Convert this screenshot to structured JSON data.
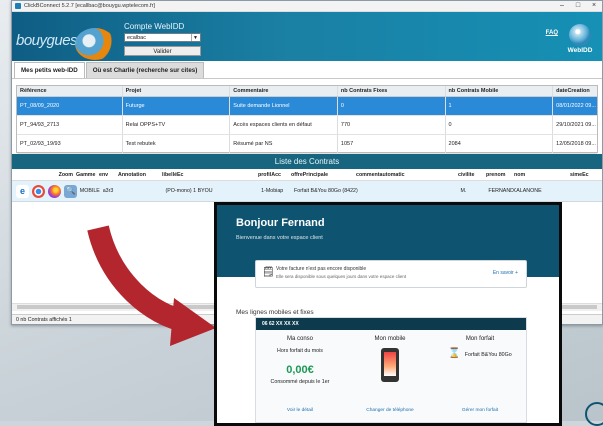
{
  "window": {
    "title": "ClickBConnect 5.2.7 [ecallbac@bouygu.wptelecom.fr]",
    "controls": [
      "–",
      "□",
      "×"
    ]
  },
  "header": {
    "brand": "bouygues",
    "compte_label": "Compte WebIDD",
    "compte_value": "ecalbac",
    "valider_label": "Valider",
    "faq_label": "FAQ",
    "webidd_label": "WebIDD"
  },
  "tabs": [
    {
      "label": "Mes petits web-IDD",
      "active": true
    },
    {
      "label": "Où est Charlie (recherche sur cites)",
      "active": false
    }
  ],
  "accounts_table": {
    "columns": [
      "Référence",
      "Projet",
      "Commentaire",
      "nb Contrats Fixes",
      "nb Contrats Mobile",
      "dateCreation"
    ],
    "rows": [
      {
        "ref": "PT_08/09_2020",
        "projet": "Futurge",
        "comment": "Suite demande Lionnel",
        "fix": "0",
        "mob": "1",
        "date": "08/01/2022 09...",
        "selected": true
      },
      {
        "ref": "PT_94/93_2713",
        "projet": "Relai OPPS+TV",
        "comment": "Accès espaces clients en défaut",
        "fix": "770",
        "mob": "0",
        "date": "29/10/2021 09...",
        "selected": false
      },
      {
        "ref": "PT_02/93_19/93",
        "projet": "Test rebutek",
        "comment": "Résumé par NS",
        "fix": "1057",
        "mob": "2084",
        "date": "12/05/2018 09...",
        "selected": false
      }
    ]
  },
  "contracts": {
    "title": "Liste des Contrats",
    "columns": [
      "Zoom",
      "Gamme",
      "env",
      "Annotation",
      "libelléEc",
      "profilAcc",
      "offrePrincipale",
      "commentautomatic",
      "civilite",
      "prenom",
      "nom",
      "simeEc"
    ],
    "row": {
      "gamme": "MOBILE",
      "env": "a3r3",
      "annotation": "",
      "libelle": "(PO-mono) 1 BYOU",
      "profil": "1-Mobiap",
      "offre": "Forfait B&You 80Go (8422)",
      "commentaire": "",
      "civilite": "M.",
      "prenom": "FERNANDO",
      "nom": "ALANONE",
      "sime": ""
    },
    "icons": [
      "ie-icon",
      "chrome-icon",
      "firefox-icon",
      "zoom-icon"
    ]
  },
  "statusbar": {
    "text": "0 nb Contrats affichés 1"
  },
  "inset": {
    "greeting": "Bonjour Fernand",
    "welcome": "Bienvenue dans votre espace client",
    "alert_line1": "Votre facture n'est pas encore disponible",
    "alert_line2": "Elle sera disponible sous quelques jours dans votre espace client",
    "alert_link": "En savoir +",
    "lines_title": "Mes lignes mobiles et fixes",
    "panel_header": "06 62 XX XX XX",
    "col1_head": "Ma conso",
    "col1_sub": "Hors forfait du mois",
    "col1_amount": "0,00€",
    "col1_note": "Consommé depuis le 1er",
    "col1_foot": "Voir le détail",
    "col2_head": "Mon mobile",
    "col2_foot": "Changer de téléphone",
    "col3_head": "Mon forfait",
    "col3_sub": "Forfait B&You 80Go",
    "col3_foot": "Gérer mon forfait"
  }
}
